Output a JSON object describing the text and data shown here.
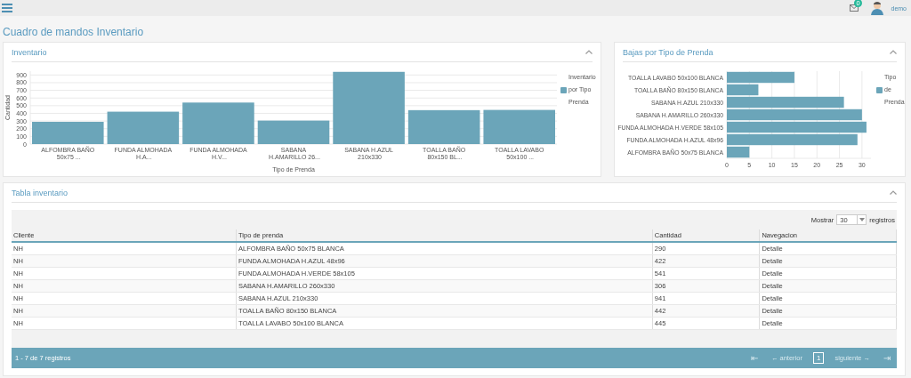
{
  "header": {
    "notification_count": "0",
    "user": "demo"
  },
  "page_title": "Cuadro de mandos Inventario",
  "inventory_panel": {
    "title": "Inventario",
    "collapsed": false,
    "chart_data": {
      "type": "bar",
      "xlabel": "Tipo de Prenda",
      "ylabel": "Cantidad",
      "categories": [
        "ALFOMBRA BAÑO 50x75 ...",
        "FUNDA ALMOHADA H.A...",
        "FUNDA ALMOHADA H.V...",
        "SABANA H.AMARILLO 26...",
        "SABANA H.AZUL 210x330",
        "TOALLA BAÑO 80x150 BL...",
        "TOALLA LAVABO 50x100 ..."
      ],
      "series": [
        {
          "name": "Inventario por Tipo Prenda",
          "color": "#6ba5b9",
          "values": [
            290,
            422,
            541,
            306,
            941,
            442,
            445
          ]
        }
      ],
      "grid": true,
      "ylim": [
        0,
        950
      ],
      "yticks": [
        0,
        100,
        200,
        300,
        400,
        500,
        600,
        700,
        800,
        900
      ]
    }
  },
  "losses_panel": {
    "title": "Bajas por Tipo de Prenda",
    "collapsed": false,
    "chart_data": {
      "type": "bar",
      "orientation": "horizontal",
      "categories": [
        "TOALLA LAVABO 50x100 BLANCA",
        "TOALLA BAÑO 80x150 BLANCA",
        "SABANA H.AZUL 210x330",
        "SABANA H.AMARILLO 260x330",
        "FUNDA ALMOHADA H.VERDE 58x105",
        "FUNDA ALMOHADA H.AZUL 48x96",
        "ALFOMBRA BAÑO 50x75 BLANCA"
      ],
      "series": [
        {
          "name": "Tipo de Prenda",
          "color": "#6ba5b9",
          "values": [
            15,
            7,
            26,
            30,
            31,
            29,
            5
          ]
        }
      ],
      "grid": true,
      "xlim": [
        0,
        32
      ],
      "xticks": [
        0,
        5,
        10,
        15,
        20,
        25,
        30
      ]
    }
  },
  "table_panel": {
    "title": "Tabla inventario",
    "collapsed": false,
    "page_size": {
      "label": "Mostrar",
      "value": "30",
      "suffix": "registros"
    },
    "columns": [
      "Cliente",
      "Tipo de prenda",
      "Cantidad",
      "Navegacion"
    ],
    "rows": [
      [
        "NH",
        "ALFOMBRA BAÑO 50x75 BLANCA",
        "290",
        "Detalle"
      ],
      [
        "NH",
        "FUNDA ALMOHADA H.AZUL 48x96",
        "422",
        "Detalle"
      ],
      [
        "NH",
        "FUNDA ALMOHADA H.VERDE 58x105",
        "541",
        "Detalle"
      ],
      [
        "NH",
        "SABANA H.AMARILLO 260x330",
        "306",
        "Detalle"
      ],
      [
        "NH",
        "SABANA H.AZUL 210x330",
        "941",
        "Detalle"
      ],
      [
        "NH",
        "TOALLA BAÑO 80x150 BLANCA",
        "442",
        "Detalle"
      ],
      [
        "NH",
        "TOALLA LAVABO 50x100 BLANCA",
        "445",
        "Detalle"
      ]
    ],
    "footer": {
      "summary": "1 - 7 de 7 registros",
      "pagination": [
        {
          "label": "⇤",
          "kind": "arrow",
          "disabled": true,
          "selected": false
        },
        {
          "label": "← anterior",
          "kind": "link",
          "disabled": true,
          "selected": false
        },
        {
          "label": "1",
          "kind": "page",
          "disabled": false,
          "selected": true
        },
        {
          "label": "siguiente →",
          "kind": "link",
          "disabled": true,
          "selected": false
        },
        {
          "label": "⇥",
          "kind": "arrow",
          "disabled": true,
          "selected": false
        }
      ]
    }
  }
}
